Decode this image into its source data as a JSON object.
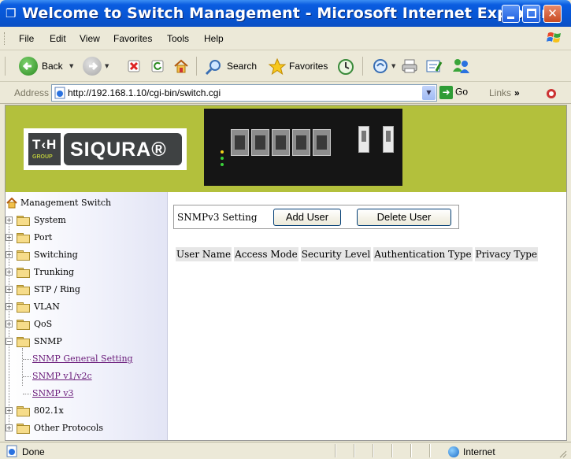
{
  "window": {
    "title": "Welcome to Switch Management - Microsoft Internet Explorer",
    "close_glyph": "✕"
  },
  "menu": [
    "File",
    "Edit",
    "View",
    "Favorites",
    "Tools",
    "Help"
  ],
  "toolbar": {
    "back_label": "Back",
    "search_label": "Search",
    "favorites_label": "Favorites"
  },
  "address": {
    "label": "Address",
    "url": "http://192.168.1.10/cgi-bin/switch.cgi",
    "go_label": "Go",
    "links_label": "Links",
    "links_chevron": "»"
  },
  "banner": {
    "logo_th": "T‹H",
    "logo_group": "GROUP",
    "logo_brand": "SIQURA®"
  },
  "tree": {
    "root": "Management Switch",
    "items": [
      {
        "label": "System",
        "expanded": false
      },
      {
        "label": "Port",
        "expanded": false
      },
      {
        "label": "Switching",
        "expanded": false
      },
      {
        "label": "Trunking",
        "expanded": false
      },
      {
        "label": "STP / Ring",
        "expanded": false
      },
      {
        "label": "VLAN",
        "expanded": false
      },
      {
        "label": "QoS",
        "expanded": false
      },
      {
        "label": "SNMP",
        "expanded": true
      },
      {
        "label": "802.1x",
        "expanded": false
      },
      {
        "label": "Other Protocols",
        "expanded": false
      }
    ],
    "snmp_children": [
      "SNMP General Setting",
      "SNMP v1/v2c",
      "SNMP v3"
    ]
  },
  "main": {
    "title": "SNMPv3 Setting",
    "add_user": "Add User",
    "delete_user": "Delete User",
    "columns": [
      "User Name",
      "Access Mode",
      "Security Level",
      "Authentication Type",
      "Privacy Type"
    ]
  },
  "status": {
    "text": "Done",
    "zone": "Internet"
  },
  "colors": {
    "titlebar": "#0a5ce0",
    "banner": "#b3c03c",
    "link": "#6a1b7a"
  }
}
